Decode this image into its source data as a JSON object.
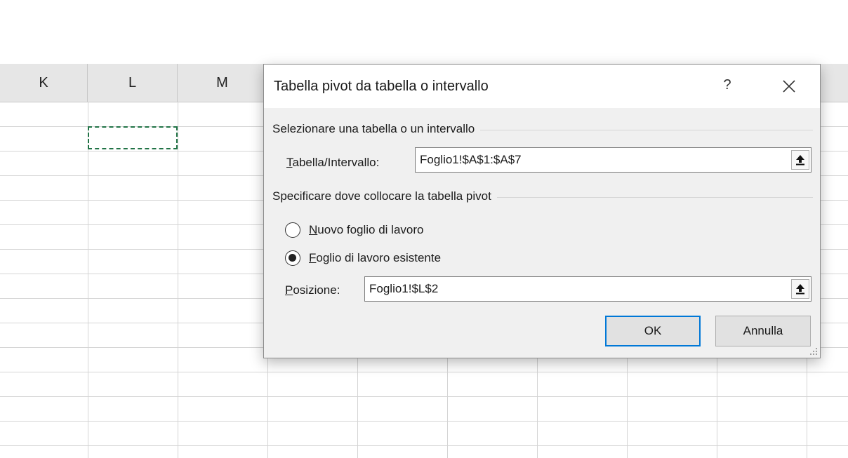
{
  "sheet": {
    "columns": [
      "K",
      "L",
      "M"
    ]
  },
  "dialog": {
    "title": "Tabella pivot da tabella o intervallo",
    "help_label": "?",
    "close_icon": "close-icon",
    "section_source": "Selezionare una tabella o un intervallo",
    "range_label_accel": "T",
    "range_label_rest": "abella/Intervallo:",
    "range_value": "Foglio1!$A$1:$A$7",
    "section_dest": "Specificare dove collocare la tabella pivot",
    "radio_new_accel": "N",
    "radio_new_rest": "uovo foglio di lavoro",
    "radio_existing_accel": "F",
    "radio_existing_rest": "oglio di lavoro esistente",
    "selected_option": "existing",
    "position_label_accel": "P",
    "position_label_rest": "osizione:",
    "position_value": "Foglio1!$L$2",
    "ok_label": "OK",
    "cancel_label": "Annulla"
  },
  "colors": {
    "selection_marquee": "#217346",
    "default_button_border": "#0078d7"
  }
}
